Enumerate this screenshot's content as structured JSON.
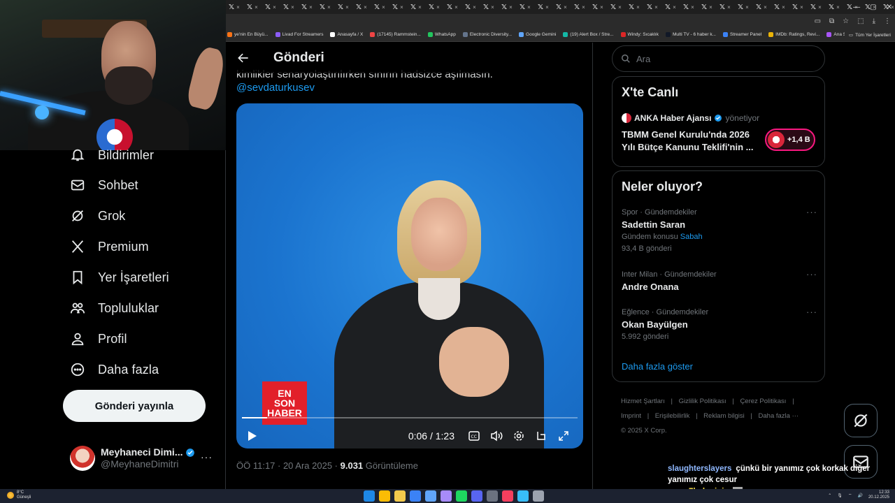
{
  "browser": {
    "tab_glyph": "𝕏",
    "tab_count": 38,
    "bookmarks": [
      {
        "label": "ye'nin En Büyü...",
        "color": "#f97316"
      },
      {
        "label": "Livad For Streamers",
        "color": "#8b5cf6"
      },
      {
        "label": "Anasayfa / X",
        "color": "#ffffff"
      },
      {
        "label": "(17145) Rammstein...",
        "color": "#ef4444"
      },
      {
        "label": "WhatsApp",
        "color": "#22c55e"
      },
      {
        "label": "Electronic Diversity...",
        "color": "#64748b"
      },
      {
        "label": "Google Gemini",
        "color": "#60a5fa"
      },
      {
        "label": "(19) Alert Box / Stre...",
        "color": "#14b8a6"
      },
      {
        "label": "Windy: Sıcaklık",
        "color": "#dc2626"
      },
      {
        "label": "Multi TV - 6 haber k...",
        "color": "#111827"
      },
      {
        "label": "Streamer Panel",
        "color": "#3b82f6"
      },
      {
        "label": "IMDb: Ratings, Revi...",
        "color": "#eab308"
      },
      {
        "label": "Ana Sayfa • HBO Max",
        "color": "#a855f7"
      }
    ],
    "all_bookmarks": "Tüm Yer İşaretleri"
  },
  "sidebar": {
    "nav": [
      {
        "key": "notifications",
        "label": "Bildirimler",
        "icon": "bell-icon"
      },
      {
        "key": "chat",
        "label": "Sohbet",
        "icon": "mail-icon"
      },
      {
        "key": "grok",
        "label": "Grok",
        "icon": "grok-icon"
      },
      {
        "key": "premium",
        "label": "Premium",
        "icon": "x-logo-icon"
      },
      {
        "key": "bookmarks",
        "label": "Yer İşaretleri",
        "icon": "bookmark-icon"
      },
      {
        "key": "communities",
        "label": "Topluluklar",
        "icon": "people-icon"
      },
      {
        "key": "profile",
        "label": "Profil",
        "icon": "person-icon"
      },
      {
        "key": "more",
        "label": "Daha fazla",
        "icon": "more-circle-icon"
      }
    ],
    "post_button": "Gönderi yayınla",
    "profile": {
      "name": "Meyhaneci Dimi...",
      "handle": "@MeyhaneDimitri",
      "more": "···"
    }
  },
  "main": {
    "title": "Gönderi",
    "tweet_text": "kimlikler senaryolaştırılırken sınırın hadsizce aşılmasın.",
    "mention": "@sevdaturkusev",
    "video": {
      "brand_lines": [
        "EN",
        "SON",
        "HABER"
      ],
      "time": "0:06 / 1:23",
      "progress": 0.075
    },
    "meta": {
      "time": "ÖÖ 11:17 · 20 Ara 2025 · ",
      "views": "9.031",
      "views_label": " Görüntüleme"
    }
  },
  "right": {
    "search_placeholder": "Ara",
    "live": {
      "title": "X'te Canlı",
      "source": "ANKA Haber Ajansı",
      "role": "yönetiyor",
      "headline": "TBMM Genel Kurulu'nda 2026 Yılı Bütçe Kanunu Teklifi'nin ...",
      "listeners": "+1,4 B"
    },
    "trends_title": "Neler oluyor?",
    "trends": [
      {
        "category": "Spor · Gündemdekiler",
        "name": "Sadettin Saran",
        "sub_prefix": "Gündem konusu ",
        "sub_link": "Sabah",
        "count": "93,4 B gönderi"
      },
      {
        "category": "Inter Milan · Gündemdekiler",
        "name": "Andre Onana",
        "sub_prefix": "",
        "sub_link": "",
        "count": ""
      },
      {
        "category": "Eğlence · Gündemdekiler",
        "name": "Okan Bayülgen",
        "sub_prefix": "",
        "sub_link": "",
        "count": "5.992 gönderi"
      }
    ],
    "show_more": "Daha fazla göster",
    "footer": {
      "links": [
        "Hizmet Şartları",
        "|",
        "Gizlilik Politikası",
        "|",
        "Çerez Politikası",
        "|",
        "Imprint",
        "|",
        "Erişilebilirlik",
        "|",
        "Reklam bilgisi",
        "|",
        "Daha fazla ···"
      ],
      "copyright": "© 2025 X Corp."
    }
  },
  "chat": [
    {
      "user": "slaughterslayers",
      "message": "çünkü bir yanımız çok korkak diğer yanımız çok cesur"
    },
    {
      "user": "7balonjoje",
      "message": ""
    }
  ],
  "taskbar": {
    "weather_temp": "8°C",
    "weather_desc": "Güneşli",
    "time": "12:33",
    "date": "20.12.2025",
    "app_colors": [
      "#1e88e5",
      "#fbbc05",
      "#f2c94c",
      "#3b82f6",
      "#60a5fa",
      "#a78bfa",
      "#1ed760",
      "#5865f2",
      "#6b7280",
      "#f43f5e",
      "#38bdf8",
      "#9ca3af"
    ]
  }
}
